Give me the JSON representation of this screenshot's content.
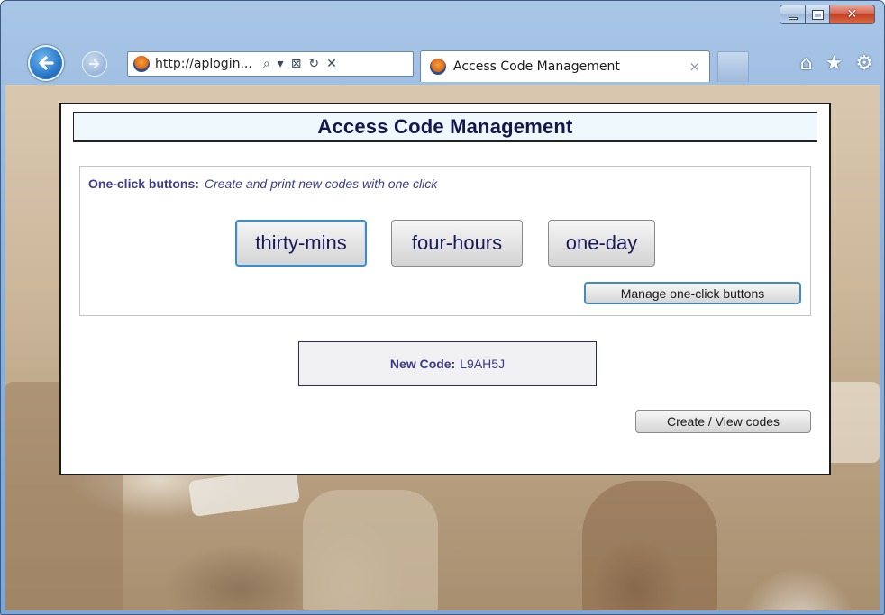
{
  "browser": {
    "address_text": "http://aplogin...",
    "address_tools": {
      "search": "⌕",
      "dropdown": "▾",
      "compat": "⊠",
      "refresh": "↻",
      "stop": "✕"
    },
    "tab_title": "Access Code Management",
    "tab_close": "×",
    "caption": {
      "close": "✕"
    },
    "toolbar_icons": {
      "home": "⌂",
      "favorites": "★",
      "tools": "⚙"
    },
    "accent_color": "#2a78c8"
  },
  "page": {
    "title": "Access Code Management",
    "one_click": {
      "label": "One-click buttons:",
      "description": "Create and print new codes with one click",
      "buttons": [
        {
          "label": "thirty-mins"
        },
        {
          "label": "four-hours"
        },
        {
          "label": "one-day"
        }
      ],
      "manage_label": "Manage one-click buttons"
    },
    "new_code": {
      "label": "New Code:",
      "value": "L9AH5J"
    },
    "create_view_label": "Create / View codes"
  }
}
